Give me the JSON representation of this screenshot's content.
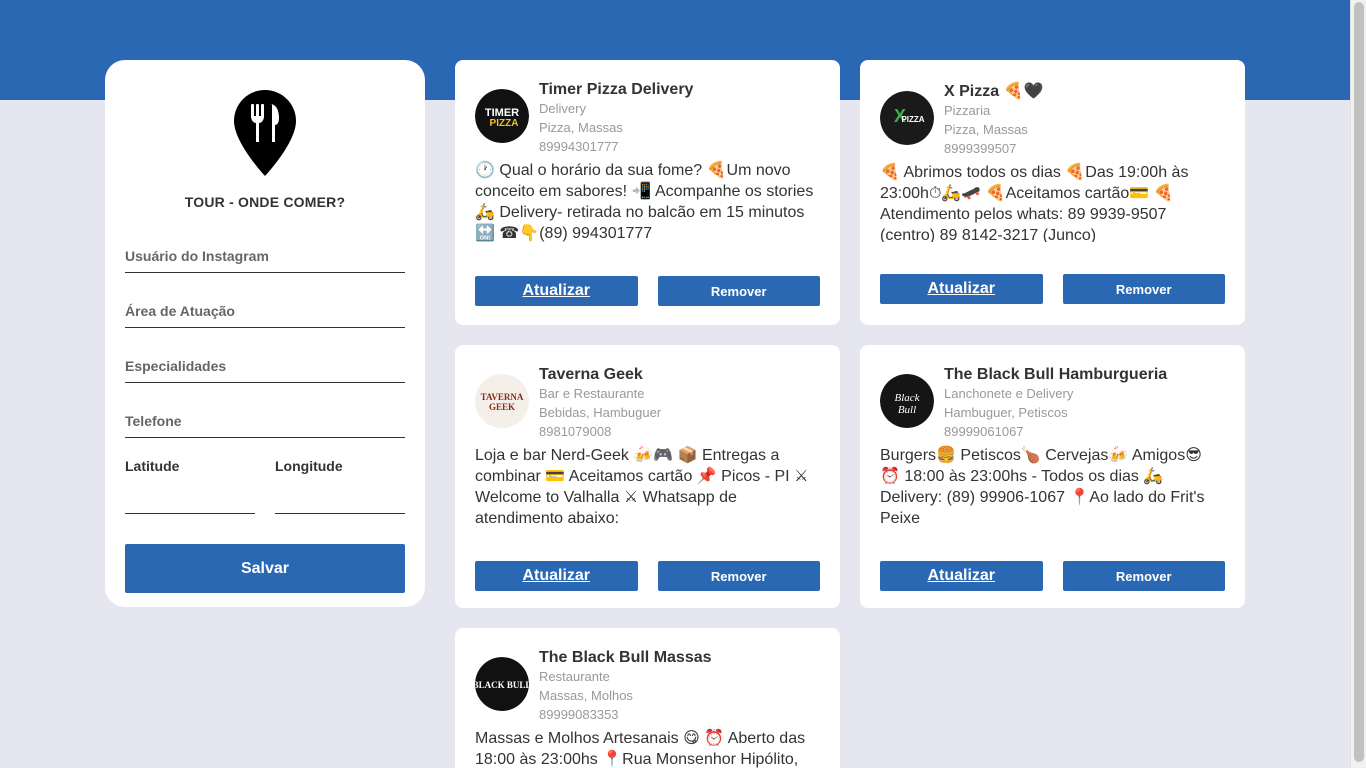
{
  "app": {
    "brand_title": "TOUR - ONDE COMER?"
  },
  "form": {
    "instagram_placeholder": "Usuário do Instagram",
    "area_placeholder": "Área de Atuação",
    "specialties_placeholder": "Especialidades",
    "phone_placeholder": "Telefone",
    "latitude_label": "Latitude",
    "longitude_label": "Longitude",
    "save_label": "Salvar"
  },
  "cards": [
    {
      "name": "Timer Pizza Delivery",
      "category": "Delivery",
      "specialties": "Pizza, Massas",
      "phone": "89994301777",
      "bio": "🕐 Qual o horário da sua fome? 🍕Um novo conceito em sabores! 📲 Acompanhe os stories 🛵 Delivery- retirada no balcão em 15 minutos 🔛 ☎👇(89) 994301777",
      "avatar_text": "TIMER PIZZA",
      "update_label": "Atualizar",
      "remove_label": "Remover"
    },
    {
      "name": "X Pizza 🍕🖤",
      "category": "Pizzaria",
      "specialties": "Pizza, Massas",
      "phone": "8999399507",
      "bio": "🍕 Abrimos todos os dias 🍕Das 19:00h às 23:00h⏱🛵🛹 🍕Aceitamos cartão💳 🍕 Atendimento pelos whats: 89 9939-9507 (centro) 89 8142-3217 (Junco)",
      "avatar_text": "X PIZZA",
      "update_label": "Atualizar",
      "remove_label": "Remover"
    },
    {
      "name": "Taverna Geek",
      "category": "Bar e Restaurante",
      "specialties": "Bebidas, Hambuguer",
      "phone": "8981079008",
      "bio": "Loja e bar Nerd-Geek 🍻🎮 📦 Entregas a combinar 💳 Aceitamos cartão 📌 Picos - PI ⚔ Welcome to Valhalla ⚔ Whatsapp de atendimento abaixo:",
      "avatar_text": "TAVERNA GEEK",
      "update_label": "Atualizar",
      "remove_label": "Remover"
    },
    {
      "name": "The Black Bull Hamburgueria",
      "category": "Lanchonete e Delivery",
      "specialties": "Hambuguer, Petiscos",
      "phone": "89999061067",
      "bio": "Burgers🍔 Petiscos🍗 Cervejas🍻 Amigos😎 ⏰ 18:00 às 23:00hs - Todos os dias 🛵 Delivery: (89) 99906-1067 📍Ao lado do Frit's Peixe",
      "avatar_text": "BLACK BULL",
      "update_label": "Atualizar",
      "remove_label": "Remover"
    },
    {
      "name": "The Black Bull Massas",
      "category": "Restaurante",
      "specialties": "Massas, Molhos",
      "phone": "89999083353",
      "bio": "Massas e Molhos Artesanais 😋 ⏰ Aberto das 18:00 às 23:00hs 📍Rua Monsenhor Hipólito,",
      "avatar_text": "BLACK BULL",
      "update_label": "Atualizar",
      "remove_label": "Remover"
    }
  ]
}
